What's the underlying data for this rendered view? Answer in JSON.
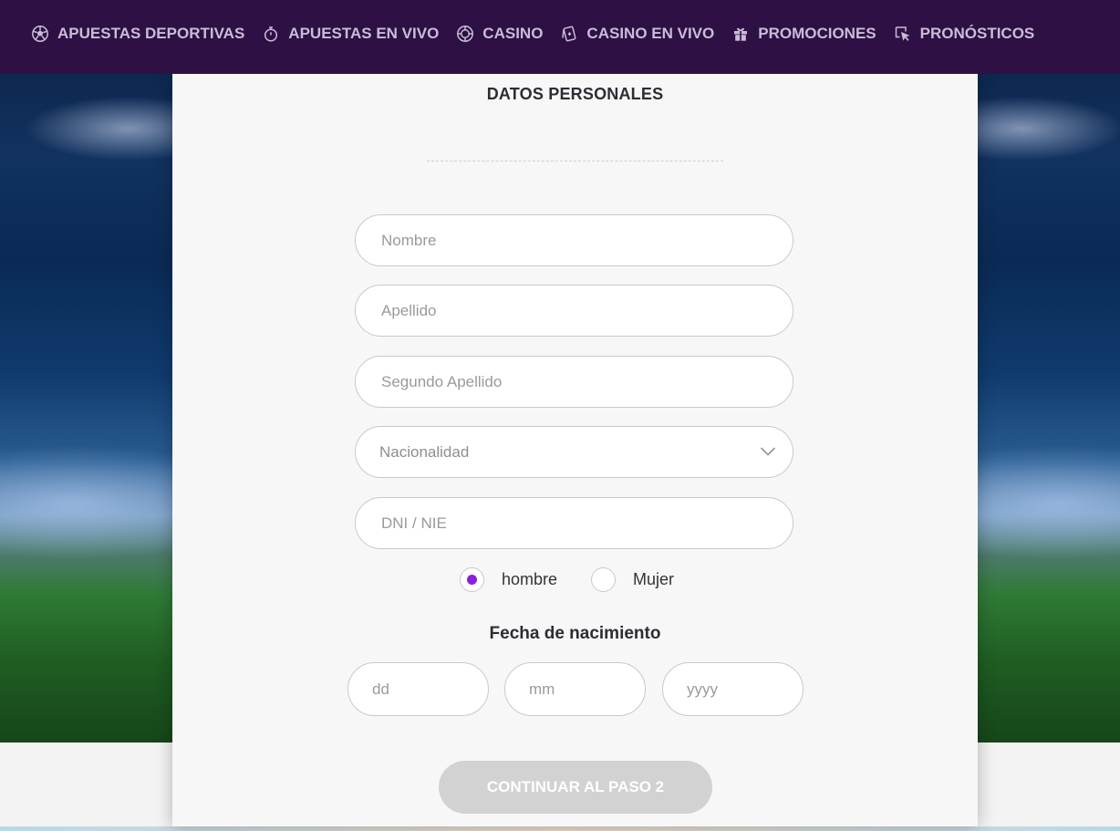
{
  "nav": {
    "items": [
      {
        "label": "APUESTAS DEPORTIVAS",
        "icon": "soccer-ball-icon"
      },
      {
        "label": "APUESTAS EN VIVO",
        "icon": "stopwatch-icon"
      },
      {
        "label": "CASINO",
        "icon": "roulette-chip-icon"
      },
      {
        "label": "CASINO EN VIVO",
        "icon": "playing-cards-icon"
      },
      {
        "label": "PROMOCIONES",
        "icon": "gift-icon"
      },
      {
        "label": "PRONÓSTICOS",
        "icon": "cursor-click-icon"
      }
    ]
  },
  "form": {
    "title": "DATOS PERSONALES",
    "fields": {
      "nombre": {
        "placeholder": "Nombre",
        "value": ""
      },
      "apellido": {
        "placeholder": "Apellido",
        "value": ""
      },
      "segundo_apellido": {
        "placeholder": "Segundo Apellido",
        "value": ""
      },
      "nacionalidad": {
        "selected": "Nacionalidad"
      },
      "dni": {
        "placeholder": "DNI / NIE",
        "value": ""
      }
    },
    "gender": {
      "options": [
        {
          "label": "hombre",
          "checked": true
        },
        {
          "label": "Mujer",
          "checked": false
        }
      ]
    },
    "dob": {
      "title": "Fecha de nacimiento",
      "day_placeholder": "dd",
      "month_placeholder": "mm",
      "year_placeholder": "yyyy"
    },
    "continue_label": "CONTINUAR AL PASO 2"
  },
  "colors": {
    "nav_bg": "#2e1045",
    "nav_text": "#c9bdd6",
    "radio_accent": "#8a1fe0",
    "button_disabled": "#d2d2d2"
  }
}
